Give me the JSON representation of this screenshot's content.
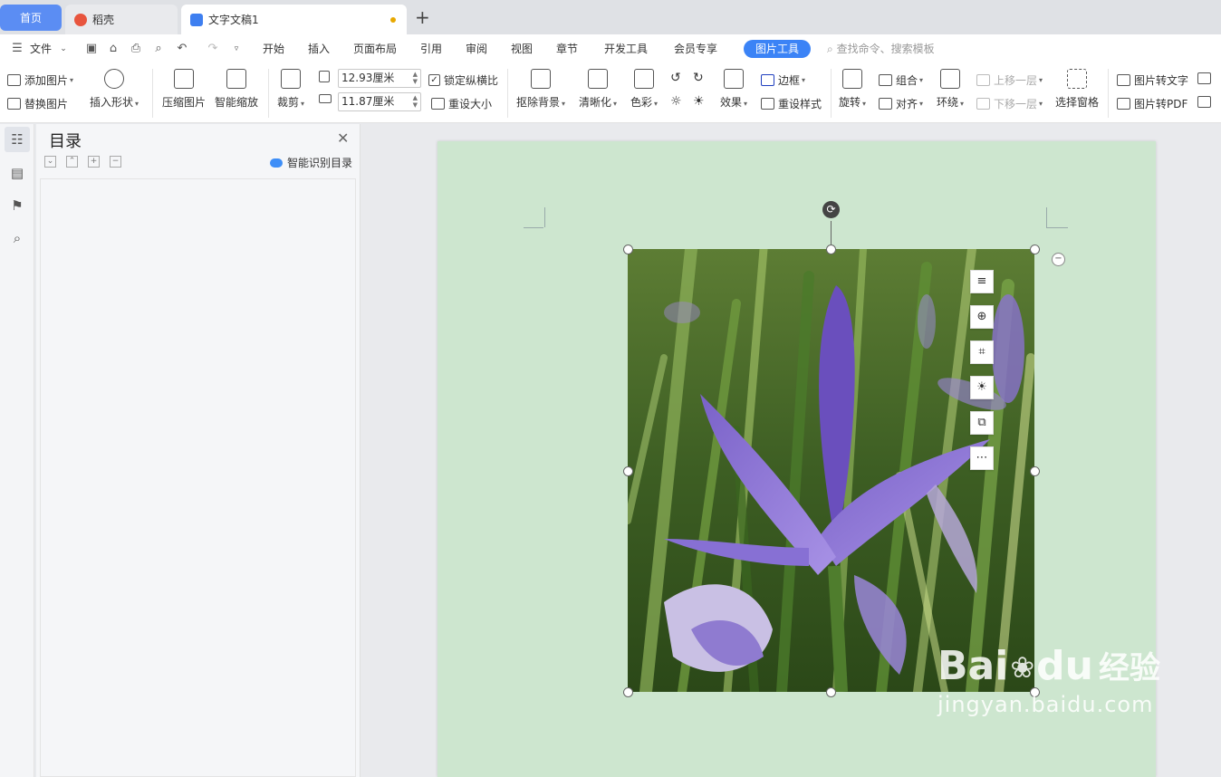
{
  "tabs": {
    "home": "首页",
    "daoke": "稻壳",
    "doc": "文字文稿1",
    "new_tab": "+"
  },
  "menu": {
    "file": "文件",
    "items": [
      "开始",
      "插入",
      "页面布局",
      "引用",
      "审阅",
      "视图",
      "章节",
      "开发工具",
      "会员专享"
    ],
    "active": "图片工具",
    "search_placeholder": "查找命令、搜索模板"
  },
  "ribbon": {
    "add_image": "添加图片",
    "replace_image": "替换图片",
    "insert_shape": "插入形状",
    "compress": "压缩图片",
    "smart_zoom": "智能缩放",
    "crop": "裁剪",
    "height_value": "12.93厘米",
    "width_value": "11.87厘米",
    "lock_ratio": "锁定纵横比",
    "reset_size": "重设大小",
    "remove_bg": "抠除背景",
    "sharpen": "清晰化",
    "color": "色彩",
    "effects": "效果",
    "border": "边框",
    "reset_style": "重设样式",
    "rotate": "旋转",
    "group": "组合",
    "align": "对齐",
    "wrap": "环绕",
    "bring_forward": "上移一层",
    "send_backward": "下移一层",
    "selection_pane": "选择窗格",
    "img_to_text": "图片转文字",
    "img_to_pdf": "图片转PDF"
  },
  "toc": {
    "title": "目录",
    "smart_detect": "智能识别目录"
  },
  "float_toolbar": [
    "layout-options-icon",
    "zoom-icon",
    "crop-icon",
    "idea-icon",
    "convert-icon",
    "more-icon"
  ],
  "watermark": {
    "brand": "Bai",
    "brand2": "du",
    "cn": "经验",
    "url": "jingyan.baidu.com"
  },
  "colors": {
    "accent": "#3b83f6",
    "page_bg": "#cde6cf",
    "home_tab": "#5b8df3"
  }
}
